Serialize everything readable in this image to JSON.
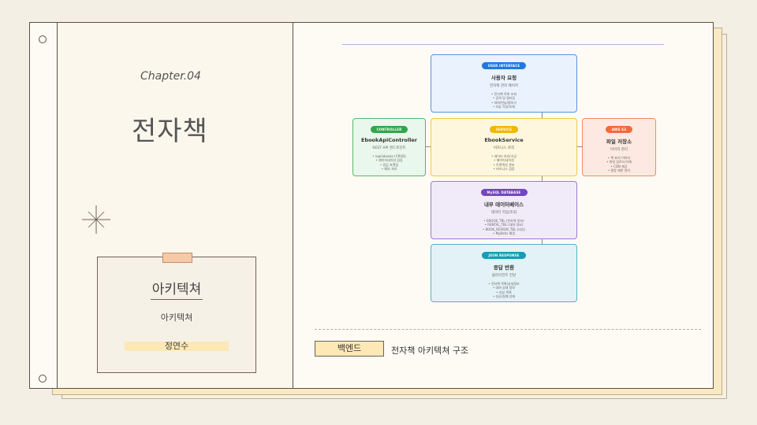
{
  "cover": {
    "chapter": "Chapter.04",
    "title": "전자책",
    "card_title": "아키텍쳐",
    "card_subtitle": "아키텍쳐",
    "author": "정연수"
  },
  "footer": {
    "tag": "백엔드",
    "caption": "전자책 아키텍쳐 구조"
  },
  "diagram": {
    "user": {
      "badge": "USER INTERFACE",
      "title": "사용자 요청",
      "subtitle": "전자책 관리 페이지",
      "items": [
        "• 전자책 목록 조회",
        "• 검색 및 필터링",
        "• 대여/반납/찜하기",
        "• 리뷰 작성/조회"
      ],
      "color": "#1f7ae0"
    },
    "controller": {
      "badge": "CONTROLLER",
      "title": "EbookApiController",
      "subtitle": "REST API 엔드포인트",
      "items": [
        "• /api/ebooks (CRUD)",
        "• 페이지네이션 검증",
        "• 응답 포맷팅",
        "• 예외 처리"
      ],
      "color": "#2ea84a"
    },
    "service": {
      "badge": "SERVICE",
      "title": "EbookService",
      "subtitle": "비즈니스 로직",
      "items": [
        "• 데이터 처리/가공",
        "• 페이지네이션",
        "• 트랜잭션 관리",
        "• 비즈니스 검증"
      ],
      "color": "#f2b705"
    },
    "storage": {
      "badge": "AWS S3",
      "title": "파일 저장소",
      "subtitle": "이미지 관리",
      "items": [
        "• 책 표지 이미지",
        "• 파일 업로드/삭제",
        "• CDN 제공",
        "• 용량 제한 관리"
      ],
      "color": "#f26a3d"
    },
    "database": {
      "badge": "MySQL DATABASE",
      "title": "내부 데이터베이스",
      "subtitle": "데이터 저장/조회",
      "items": [
        "• EBOOK_TBL (전자책 정보)",
        "• RENTAL_TBL (대여 정보)",
        "• BOOK_REVIEW_TBL (리뷰)",
        "• MyBatis 매핑"
      ],
      "color": "#7446c2"
    },
    "response": {
      "badge": "JSON RESPONSE",
      "title": "응답 반환",
      "subtitle": "클라이언트 전달",
      "items": [
        "• 전자책 목록/상세정보",
        "• 대여 상태 정보",
        "• 리뷰 목록",
        "• 성공/실패 상태"
      ],
      "color": "#159db5"
    }
  }
}
